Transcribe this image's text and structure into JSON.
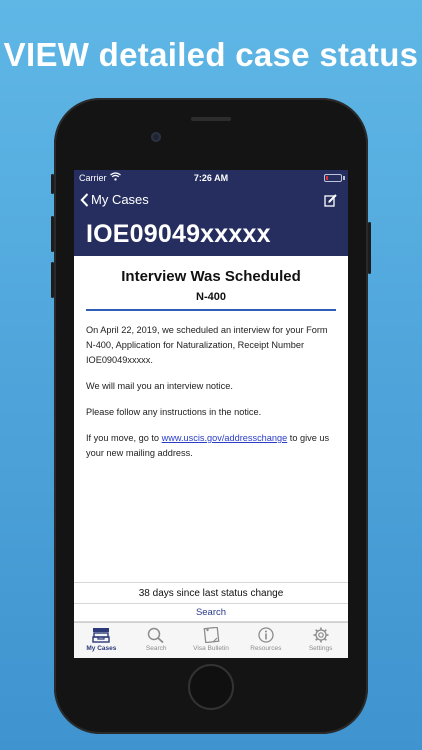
{
  "headline": "VIEW detailed case status",
  "status_bar": {
    "carrier": "Carrier",
    "time": "7:26 AM",
    "battery_level": 0.15
  },
  "nav": {
    "back_label": "My Cases",
    "receipt_number": "IOE09049xxxxx"
  },
  "case": {
    "title": "Interview Was Scheduled",
    "form": "N-400",
    "paragraph1": "On April 22, 2019, we scheduled an interview for your Form N-400, Application for Naturalization, Receipt Number IOE09049xxxxx.",
    "paragraph2": "We will mail you an interview notice.",
    "paragraph3": "Please follow any instructions in the notice.",
    "paragraph4_pre": "If you move, go to ",
    "paragraph4_link": "www.uscis.gov/addresschange",
    "paragraph4_post": " to give us your new mailing address."
  },
  "footer": {
    "days_since": "38 days since last status change",
    "search_label": "Search"
  },
  "tabs": [
    {
      "label": "My Cases",
      "icon": "inbox-icon",
      "active": true
    },
    {
      "label": "Search",
      "icon": "search-icon",
      "active": false
    },
    {
      "label": "Visa Bulletin",
      "icon": "bulletin-icon",
      "active": false
    },
    {
      "label": "Resources",
      "icon": "info-icon",
      "active": false
    },
    {
      "label": "Settings",
      "icon": "gear-icon",
      "active": false
    }
  ],
  "colors": {
    "nav_bg": "#252e5f",
    "accent": "#2e5db8",
    "link": "#2a3dc8",
    "background": "#4aa3dc"
  }
}
